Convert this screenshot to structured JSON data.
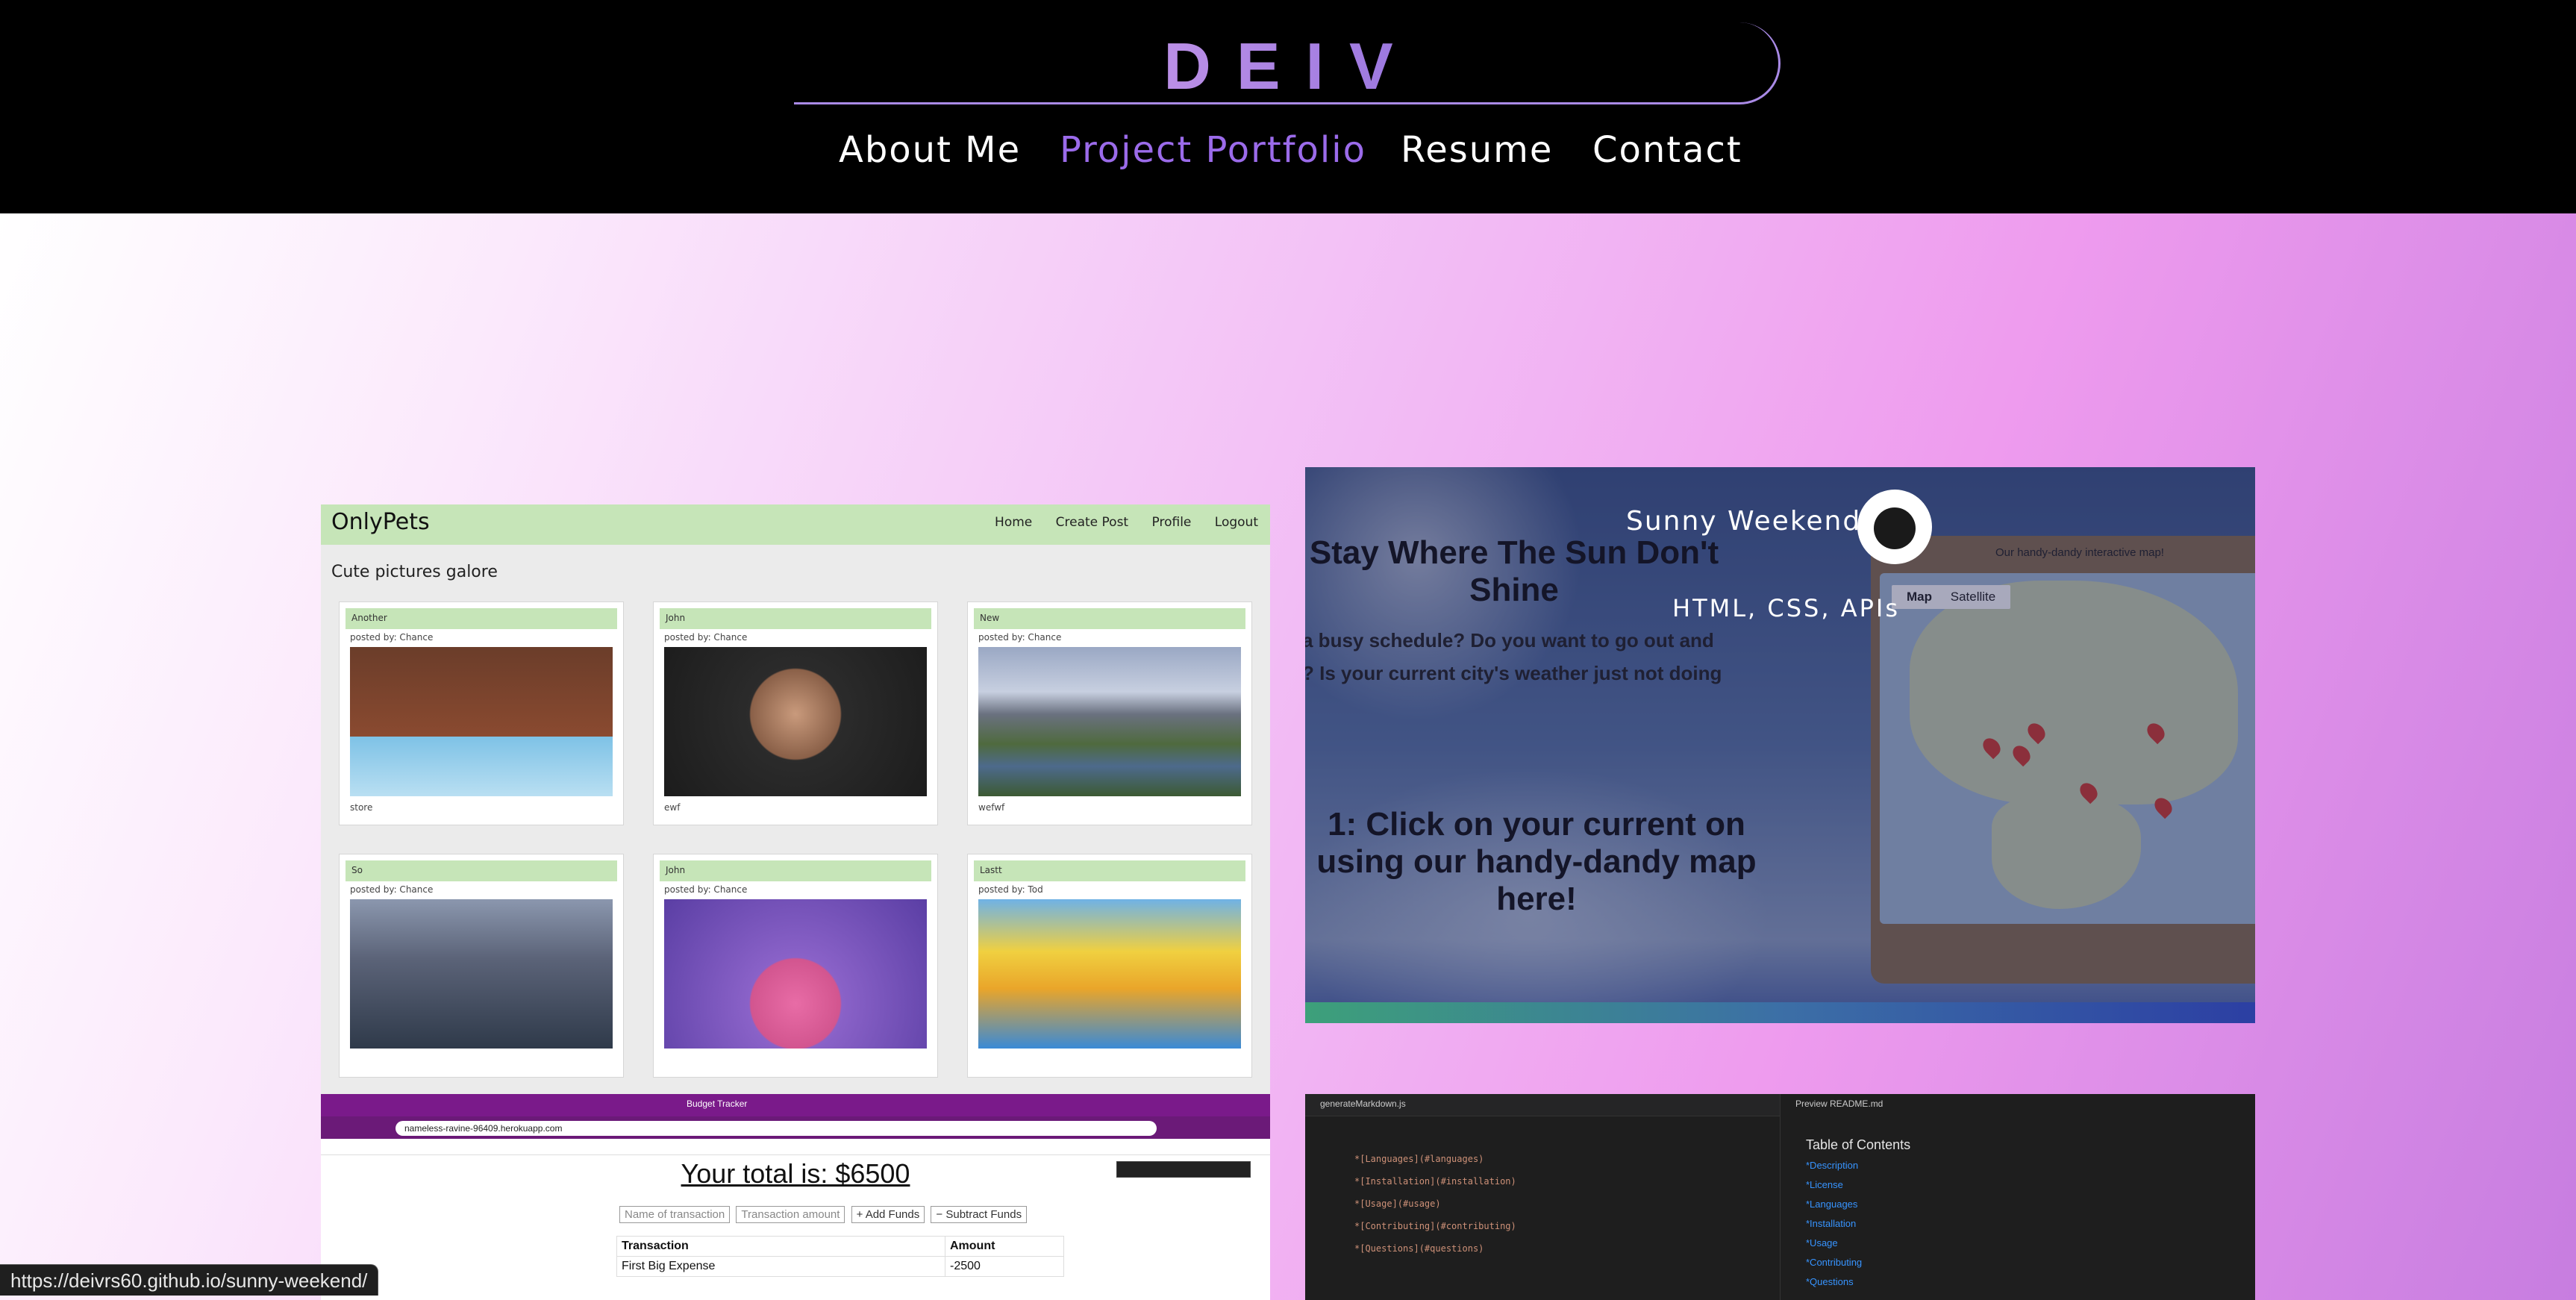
{
  "header": {
    "logo": "DEIV",
    "nav": [
      {
        "label": "About Me",
        "active": false
      },
      {
        "label": "Project Portfolio",
        "active": true
      },
      {
        "label": "Resume",
        "active": false
      },
      {
        "label": "Contact",
        "active": false
      }
    ]
  },
  "colors": {
    "accent": "#9b6bea",
    "header_bg": "#000000"
  },
  "projects": {
    "onlypets": {
      "brand": "OnlyPets",
      "nav": [
        "Home",
        "Create Post",
        "Profile",
        "Logout"
      ],
      "subtitle": "Cute pictures galore",
      "posts": [
        {
          "title": "Another",
          "by": "posted by: Chance",
          "caption": "store"
        },
        {
          "title": "John",
          "by": "posted by: Chance",
          "caption": "ewf"
        },
        {
          "title": "New",
          "by": "posted by: Chance",
          "caption": "wefwf"
        },
        {
          "title": "So",
          "by": "posted by: Chance",
          "caption": ""
        },
        {
          "title": "John",
          "by": "posted by: Chance",
          "caption": ""
        },
        {
          "title": "Lastt",
          "by": "posted by: Tod",
          "caption": ""
        }
      ]
    },
    "sunny": {
      "heading": "Stay Where The Sun Don't Shine",
      "body_line1": "a busy schedule? Do you want to go out and",
      "body_line2": "? Is your current city's weather just not doing",
      "step": "1: Click on your current on using our handy-dandy map here!",
      "map_caption": "Our handy-dandy interactive map!",
      "map_tabs": [
        "Map",
        "Satellite"
      ],
      "overlay_title": "Sunny Weekend",
      "overlay_tech": "HTML, CSS, APIs",
      "github_icon": "github-icon"
    },
    "budget": {
      "tab_title": "Budget Tracker",
      "url": "nameless-ravine-96409.herokuapp.com",
      "total": "Your total is: $6500",
      "name_placeholder": "Name of transaction",
      "amount_placeholder": "Transaction amount",
      "add_label": "+ Add Funds",
      "subtract_label": "− Subtract Funds",
      "columns": [
        "Transaction",
        "Amount"
      ],
      "rows": [
        [
          "First Big Expense",
          "-2500"
        ]
      ]
    },
    "readme": {
      "tab_left": "generateMarkdown.js",
      "tab_right": "Preview README.md",
      "code": [
        "*[Languages](#languages)",
        "*[Installation](#installation)",
        "*[Usage](#usage)",
        "*[Contributing](#contributing)",
        "*[Questions](#questions)"
      ],
      "toc_title": "Table of Contents",
      "toc": [
        "*Description",
        "*License",
        "*Languages",
        "*Installation",
        "*Usage",
        "*Contributing",
        "*Questions"
      ]
    }
  },
  "status_url": "https://deivrs60.github.io/sunny-weekend/"
}
